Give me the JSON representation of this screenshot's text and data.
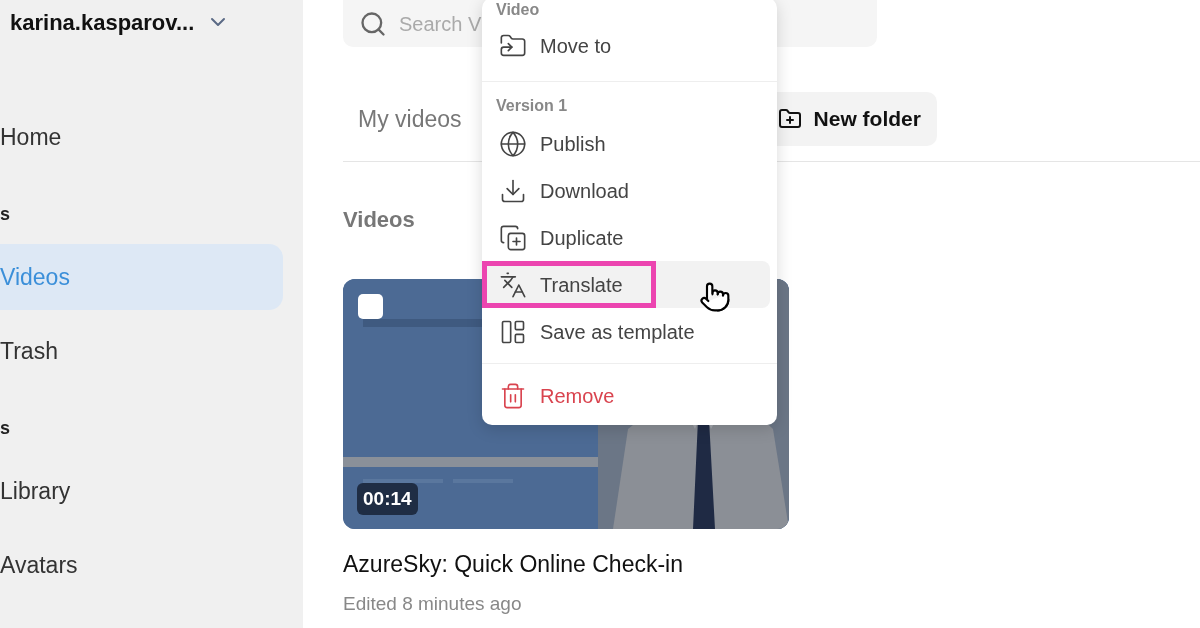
{
  "sidebar": {
    "account": "karina.kasparov...",
    "items": [
      {
        "kind": "item",
        "label": "Home",
        "selected": false
      },
      {
        "kind": "section",
        "label": "s"
      },
      {
        "kind": "item",
        "label": "Videos",
        "selected": true
      },
      {
        "kind": "item",
        "label": "Trash",
        "selected": false
      },
      {
        "kind": "section",
        "label": "s"
      },
      {
        "kind": "item",
        "label": "Library",
        "selected": false
      },
      {
        "kind": "item",
        "label": "Avatars",
        "selected": false
      }
    ]
  },
  "search": {
    "placeholder": "Search V"
  },
  "tabs": [
    {
      "label": "My videos",
      "selected": false
    }
  ],
  "new_folder_button": "New folder",
  "section_title": "Videos",
  "video_card": {
    "checked": false,
    "duration": "00:14",
    "title": "AzureSky: Quick Online Check-in",
    "edited": "Edited 8 minutes ago"
  },
  "context_menu": {
    "groups": [
      {
        "label": "Video",
        "items": [
          {
            "label": "Move to",
            "danger": false,
            "hovered": false,
            "annotated": false
          }
        ]
      },
      {
        "label": "Version 1",
        "items": [
          {
            "label": "Publish",
            "danger": false,
            "hovered": false,
            "annotated": false
          },
          {
            "label": "Download",
            "danger": false,
            "hovered": false,
            "annotated": false
          },
          {
            "label": "Duplicate",
            "danger": false,
            "hovered": false,
            "annotated": false
          },
          {
            "label": "Translate",
            "danger": false,
            "hovered": true,
            "annotated": true
          },
          {
            "label": "Save as template",
            "danger": false,
            "hovered": false,
            "annotated": false
          }
        ]
      },
      {
        "items": [
          {
            "label": "Remove",
            "danger": true,
            "hovered": false,
            "annotated": false
          }
        ]
      }
    ]
  }
}
